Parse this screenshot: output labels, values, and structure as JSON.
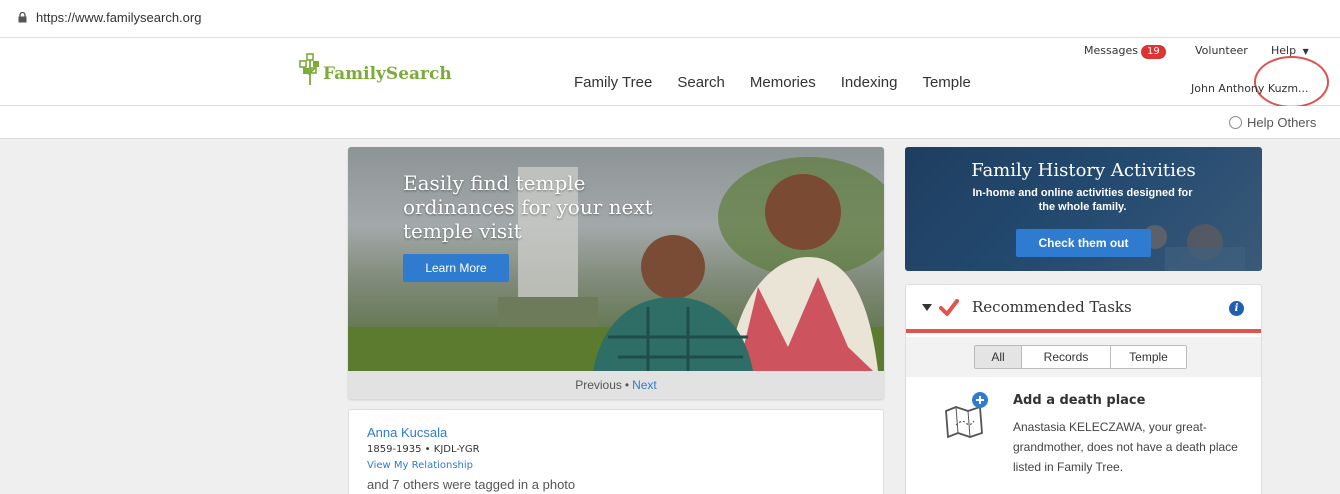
{
  "browser": {
    "url": "https://www.familysearch.org"
  },
  "header": {
    "logo_text": "FamilySearch",
    "nav": [
      {
        "label": "Family Tree"
      },
      {
        "label": "Search"
      },
      {
        "label": "Memories"
      },
      {
        "label": "Indexing"
      },
      {
        "label": "Temple"
      }
    ],
    "messages_label": "Messages",
    "messages_count": "19",
    "volunteer_label": "Volunteer",
    "help_label": "Help",
    "user_name": "John Anthony Kuzm..."
  },
  "subbar": {
    "help_others_label": "Help Others"
  },
  "hero": {
    "title": "Easily find temple ordinances for your next temple visit",
    "button_label": "Learn More",
    "previous_label": "Previous",
    "bullet": "•",
    "next_label": "Next"
  },
  "activity": {
    "person_name": "Anna Kucsala",
    "person_meta": "1859-1935 • KJDL-YGR",
    "relationship_link": "View My Relationship",
    "note": "and 7 others were tagged in a photo"
  },
  "activities_banner": {
    "title": "Family History Activities",
    "subtitle": "In-home and online activities designed for the whole family.",
    "button_label": "Check them out"
  },
  "tasks": {
    "title": "Recommended Tasks",
    "filters": [
      {
        "label": "All",
        "active": true
      },
      {
        "label": "Records",
        "active": false
      },
      {
        "label": "Temple",
        "active": false
      }
    ],
    "item_title": "Add a death place",
    "item_desc": "Anastasia KELECZAWA, your great-grandmother, does not have a death place listed in Family Tree."
  },
  "colors": {
    "brand_green": "#7cab3a",
    "link_blue": "#2e7bcf",
    "accent_red": "#e0544c",
    "badge_red": "#d33"
  }
}
